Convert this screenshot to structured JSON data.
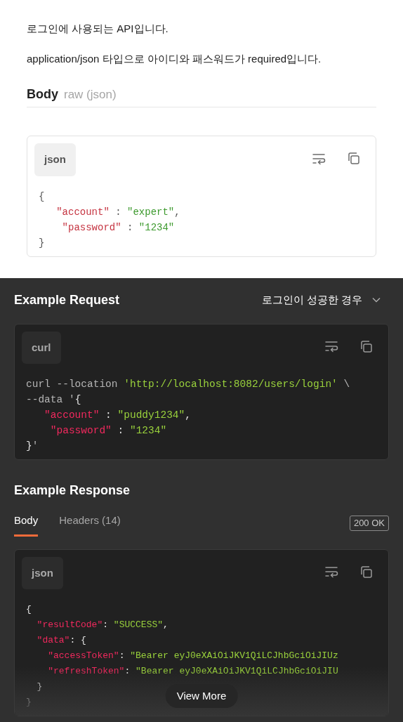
{
  "description": [
    "로그인에 사용되는 API입니다.",
    "application/json 타입으로 아이디와 패스워드가 required입니다."
  ],
  "body_section": {
    "title": "Body",
    "subtitle": "raw (json)",
    "code_block": {
      "language": "json",
      "lines": [
        [
          {
            "kind": "punct",
            "text": "{"
          }
        ],
        [
          {
            "kind": "key",
            "text": "   \"account\""
          },
          {
            "kind": "punct",
            "text": " : "
          },
          {
            "kind": "string",
            "text": "\"expert\""
          },
          {
            "kind": "punct",
            "text": ","
          }
        ],
        [
          {
            "kind": "key",
            "text": "    \"password\""
          },
          {
            "kind": "punct",
            "text": " : "
          },
          {
            "kind": "string",
            "text": "\"1234\""
          }
        ],
        [
          {
            "kind": "punct",
            "text": "}"
          }
        ]
      ]
    }
  },
  "example_request": {
    "title": "Example Request",
    "dropdown": "로그인이 성공한 경우",
    "code_block": {
      "language": "curl",
      "lines": [
        [
          {
            "kind": "plain",
            "text": "curl --location "
          },
          {
            "kind": "string",
            "text": "'http://localhost:8082/users/login'"
          },
          {
            "kind": "plain",
            "text": " \\"
          }
        ],
        [
          {
            "kind": "plain",
            "text": "--data '"
          },
          {
            "kind": "punct",
            "text": "{"
          }
        ],
        [
          {
            "kind": "key",
            "text": "   \"account\""
          },
          {
            "kind": "punct",
            "text": " : "
          },
          {
            "kind": "string",
            "text": "\"puddy1234\""
          },
          {
            "kind": "punct",
            "text": ","
          }
        ],
        [
          {
            "kind": "key",
            "text": "    \"password\""
          },
          {
            "kind": "punct",
            "text": " : "
          },
          {
            "kind": "string",
            "text": "\"1234\""
          }
        ],
        [
          {
            "kind": "punct",
            "text": "}"
          },
          {
            "kind": "plain",
            "text": "'"
          }
        ]
      ]
    }
  },
  "example_response": {
    "title": "Example Response",
    "tabs": [
      {
        "label": "Body",
        "selected": true
      },
      {
        "label": "Headers (14)",
        "selected": false
      }
    ],
    "status": "200 OK",
    "code_block": {
      "language": "json",
      "lines": [
        [
          {
            "kind": "punct",
            "text": "{"
          }
        ],
        [
          {
            "kind": "key",
            "text": "  \"resultCode\""
          },
          {
            "kind": "punct",
            "text": ": "
          },
          {
            "kind": "string",
            "text": "\"SUCCESS\""
          },
          {
            "kind": "punct",
            "text": ","
          }
        ],
        [
          {
            "kind": "key",
            "text": "  \"data\""
          },
          {
            "kind": "punct",
            "text": ": {"
          }
        ],
        [
          {
            "kind": "key",
            "text": "    \"accessToken\""
          },
          {
            "kind": "punct",
            "text": ": "
          },
          {
            "kind": "string",
            "text": "\"Bearer eyJ0eXAiOiJKV1QiLCJhbGciOiJIUz"
          }
        ],
        [
          {
            "kind": "key",
            "text": "    \"refreshToken\""
          },
          {
            "kind": "punct",
            "text": ": "
          },
          {
            "kind": "string",
            "text": "\"Bearer eyJ0eXAiOiJKV1QiLCJhbGciOiJIU"
          }
        ],
        [
          {
            "kind": "punct",
            "text": "  }"
          }
        ],
        [
          {
            "kind": "punct",
            "text": "}"
          }
        ]
      ]
    },
    "view_more": "View More"
  }
}
